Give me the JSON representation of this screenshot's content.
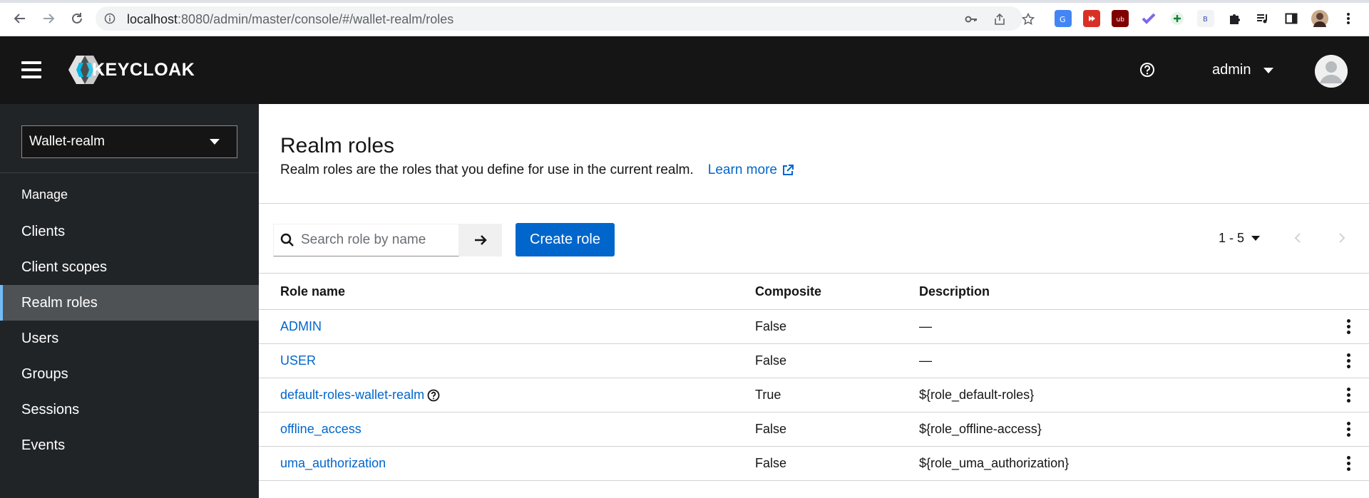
{
  "browser": {
    "url_host": "localhost",
    "url_rest": ":8080/admin/master/console/#/wallet-realm/roles"
  },
  "masthead": {
    "logo_text": "KEYCLOAK",
    "username": "admin"
  },
  "sidebar": {
    "realm": "Wallet-realm",
    "section_title": "Manage",
    "items": [
      {
        "label": "Clients",
        "active": false
      },
      {
        "label": "Client scopes",
        "active": false
      },
      {
        "label": "Realm roles",
        "active": true
      },
      {
        "label": "Users",
        "active": false
      },
      {
        "label": "Groups",
        "active": false
      },
      {
        "label": "Sessions",
        "active": false
      },
      {
        "label": "Events",
        "active": false
      }
    ]
  },
  "page": {
    "title": "Realm roles",
    "description": "Realm roles are the roles that you define for use in the current realm.",
    "learn_more": "Learn more"
  },
  "toolbar": {
    "search_placeholder": "Search role by name",
    "create_label": "Create role",
    "pagination": "1 - 5"
  },
  "table": {
    "headers": {
      "name": "Role name",
      "composite": "Composite",
      "description": "Description"
    },
    "rows": [
      {
        "name": "ADMIN",
        "composite": "False",
        "description": "—"
      },
      {
        "name": "USER",
        "composite": "False",
        "description": "—"
      },
      {
        "name": "default-roles-wallet-realm",
        "composite": "True",
        "description": "${role_default-roles}"
      },
      {
        "name": "offline_access",
        "composite": "False",
        "description": "${role_offline-access}"
      },
      {
        "name": "uma_authorization",
        "composite": "False",
        "description": "${role_uma_authorization}"
      }
    ]
  },
  "colors": {
    "accent": "#0066cc",
    "masthead": "#151515",
    "sidebar": "#212427",
    "active_indicator": "#73bcf7"
  }
}
